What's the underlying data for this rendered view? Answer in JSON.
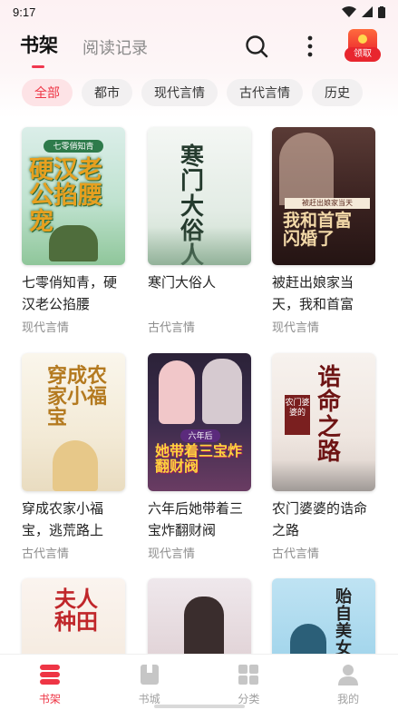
{
  "status": {
    "time": "9:17"
  },
  "header": {
    "tab_shelf": "书架",
    "tab_history": "阅读记录",
    "reward_label": "领取",
    "accent": "#f0384f"
  },
  "filters": [
    {
      "label": "全部",
      "active": true
    },
    {
      "label": "都市",
      "active": false
    },
    {
      "label": "现代言情",
      "active": false
    },
    {
      "label": "古代言情",
      "active": false
    },
    {
      "label": "历史",
      "active": false
    }
  ],
  "books": [
    {
      "title": "七零俏知青，硬汉老公掐腰",
      "genre": "现代言情",
      "cover_text": "硬汉老公掐腰宠",
      "cover_badge": "七零俏知青"
    },
    {
      "title": "寒门大俗人",
      "genre": "古代言情",
      "cover_text": "寒门大俗人"
    },
    {
      "title": "被赶出娘家当天，我和首富",
      "genre": "现代言情",
      "cover_text": "我和首富闪婚了",
      "cover_badge": "被赶出娘家当天"
    },
    {
      "title": "穿成农家小福宝，逃荒路上",
      "genre": "古代言情",
      "cover_text": "穿成农家小福宝"
    },
    {
      "title": "六年后她带着三宝炸翻财阀",
      "genre": "现代言情",
      "cover_text": "她带着三宝炸翻财阀",
      "cover_badge": "六年后"
    },
    {
      "title": "农门婆婆的诰命之路",
      "genre": "古代言情",
      "cover_text": "诰命之路",
      "cover_badge": "农门婆婆的"
    },
    {
      "title": "",
      "genre": "",
      "cover_text": "夫人种田"
    },
    {
      "title": "",
      "genre": "",
      "cover_text": ""
    },
    {
      "title": "",
      "genre": "",
      "cover_text": "贻自美女军"
    }
  ],
  "nav": [
    {
      "label": "书架",
      "icon": "bookshelf-icon",
      "active": true
    },
    {
      "label": "书城",
      "icon": "bookstore-icon",
      "active": false
    },
    {
      "label": "分类",
      "icon": "category-grid-icon",
      "active": false
    },
    {
      "label": "我的",
      "icon": "profile-icon",
      "active": false
    }
  ]
}
